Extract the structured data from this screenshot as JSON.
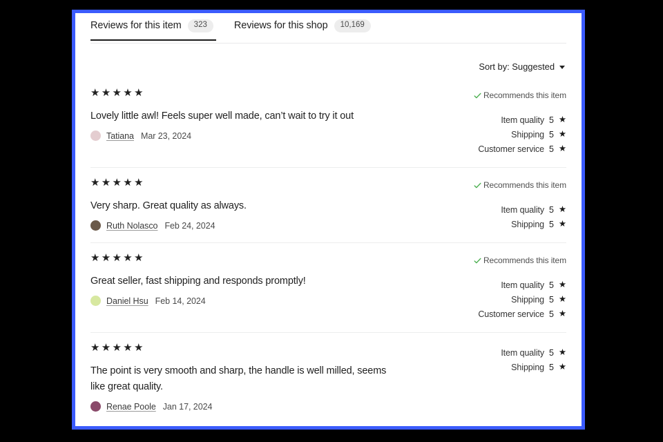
{
  "tabs": [
    {
      "label": "Reviews for this item",
      "badge": "323",
      "active": true
    },
    {
      "label": "Reviews for this shop",
      "badge": "10,169",
      "active": false
    }
  ],
  "sort": {
    "label": "Sort by: Suggested",
    "icon": "chevron-down-icon"
  },
  "labels": {
    "recommends": "Recommends this item",
    "item_quality": "Item quality",
    "shipping": "Shipping",
    "customer_service": "Customer service",
    "star_glyph": "★★★★★",
    "single_star": "★"
  },
  "colors": {
    "frame_accent": "#3b5bfd",
    "check_green": "#4caf50",
    "badge_bg": "#ededed",
    "divider": "#eceded",
    "text_primary": "#1f1f1f"
  },
  "reviews": [
    {
      "stars": "★★★★★",
      "rating": 5,
      "text": "Lovely little awl! Feels super well made, can’t wait to try it out",
      "author": "Tatiana",
      "date": "Mar 23, 2024",
      "avatar_color": "#e4cdd0",
      "recommends": "Recommends this item",
      "ratings": [
        {
          "label": "Item quality",
          "value": "5"
        },
        {
          "label": "Shipping",
          "value": "5"
        },
        {
          "label": "Customer service",
          "value": "5"
        }
      ]
    },
    {
      "stars": "★★★★★",
      "rating": 5,
      "text": "Very sharp. Great quality as always.",
      "author": "Ruth Nolasco",
      "date": "Feb 24, 2024",
      "avatar_color": "#6b5a4a",
      "recommends": "Recommends this item",
      "ratings": [
        {
          "label": "Item quality",
          "value": "5"
        },
        {
          "label": "Shipping",
          "value": "5"
        }
      ]
    },
    {
      "stars": "★★★★★",
      "rating": 5,
      "text": "Great seller, fast shipping and responds promptly!",
      "author": "Daniel Hsu",
      "date": "Feb 14, 2024",
      "avatar_color": "#d7e8a0",
      "recommends": "Recommends this item",
      "ratings": [
        {
          "label": "Item quality",
          "value": "5"
        },
        {
          "label": "Shipping",
          "value": "5"
        },
        {
          "label": "Customer service",
          "value": "5"
        }
      ]
    },
    {
      "stars": "★★★★★",
      "rating": 5,
      "text": "The point is very smooth and sharp, the handle is well milled, seems like great quality.",
      "author": "Renae Poole",
      "date": "Jan 17, 2024",
      "avatar_color": "#8a4a6a",
      "recommends": "",
      "ratings": [
        {
          "label": "Item quality",
          "value": "5"
        },
        {
          "label": "Shipping",
          "value": "5"
        }
      ]
    }
  ]
}
